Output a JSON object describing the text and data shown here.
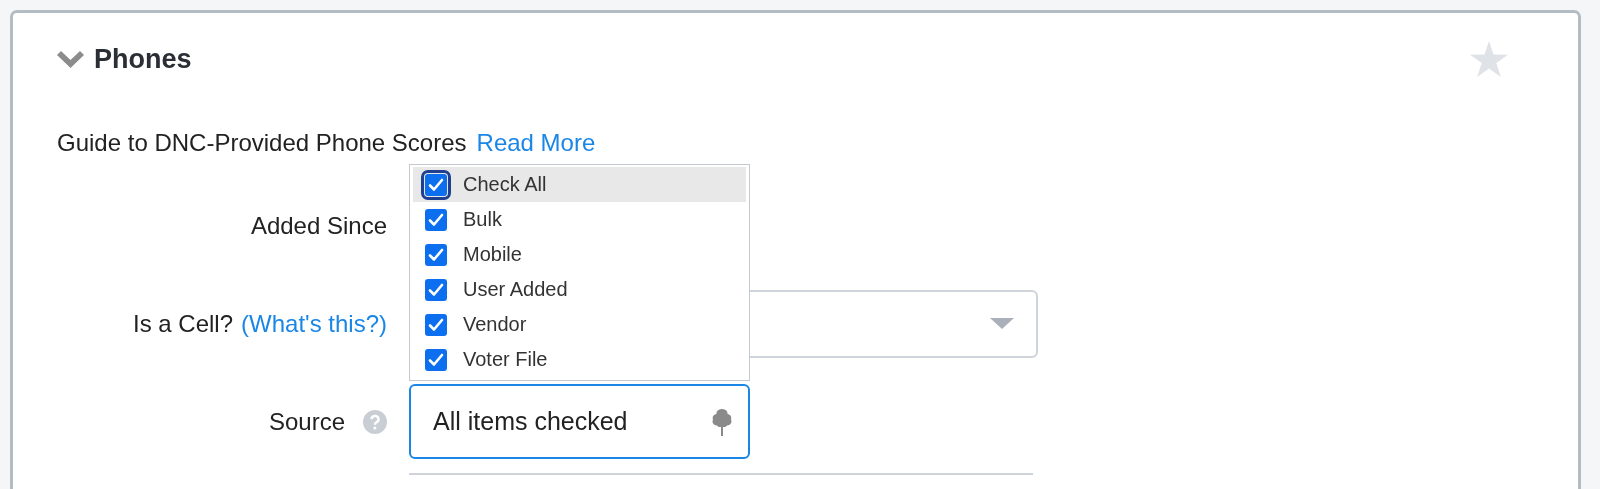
{
  "section": {
    "title": "Phones",
    "expanded": true,
    "starred": false
  },
  "guide": {
    "text": "Guide to DNC-Provided Phone Scores",
    "link": "Read More"
  },
  "fields": [
    {
      "kind": "covered",
      "label": "Added Since"
    },
    {
      "kind": "select",
      "label": "Is a Cell?",
      "help_link": "(What's this?)",
      "focused": false
    },
    {
      "kind": "multiselect",
      "label": "Source",
      "help": true,
      "value": "All items checked",
      "focused": true
    }
  ],
  "source_dropdown": {
    "items": [
      {
        "label": "Check All",
        "checked": true,
        "highlighted": true
      },
      {
        "label": "Bulk",
        "checked": true,
        "highlighted": false
      },
      {
        "label": "Mobile",
        "checked": true,
        "highlighted": false
      },
      {
        "label": "User Added",
        "checked": true,
        "highlighted": false
      },
      {
        "label": "Vendor",
        "checked": true,
        "highlighted": false
      },
      {
        "label": "Voter File",
        "checked": true,
        "highlighted": false
      }
    ]
  }
}
